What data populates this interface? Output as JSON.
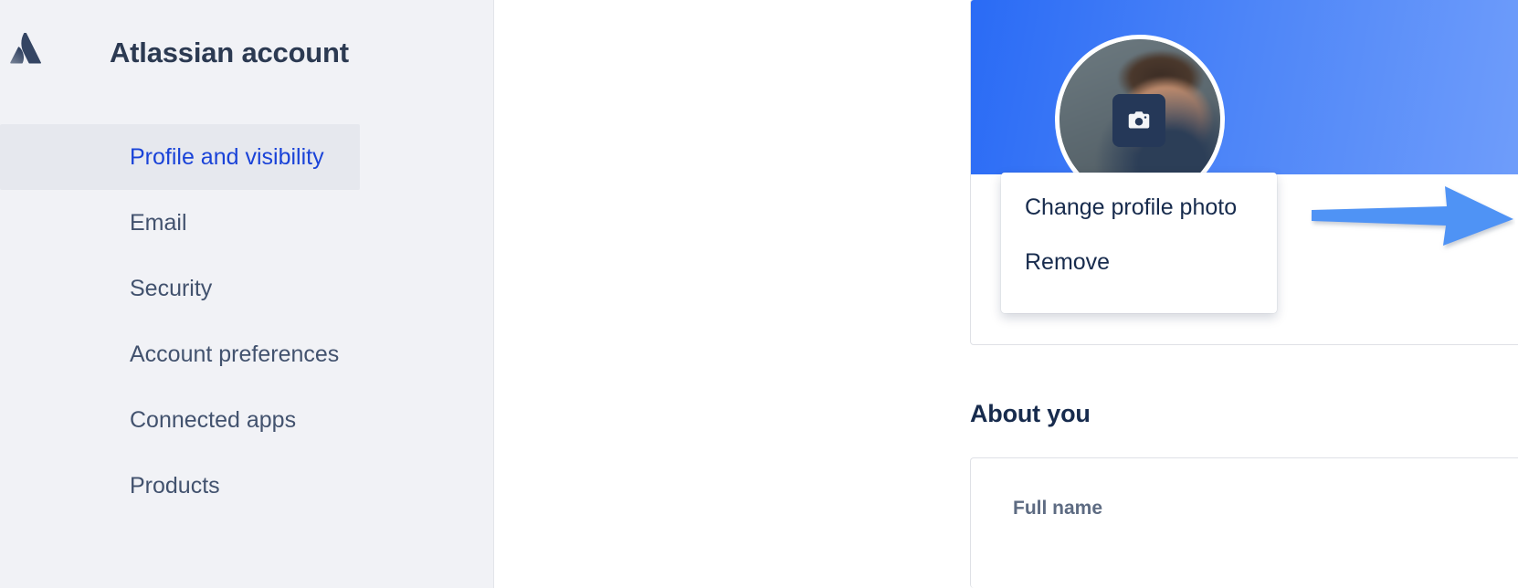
{
  "app": {
    "title": "Atlassian account",
    "logo_icon": "atlassian-logo-icon"
  },
  "sidebar": {
    "items": [
      {
        "label": "Profile and visibility",
        "selected": true
      },
      {
        "label": "Email",
        "selected": false
      },
      {
        "label": "Security",
        "selected": false
      },
      {
        "label": "Account preferences",
        "selected": false
      },
      {
        "label": "Connected apps",
        "selected": false
      },
      {
        "label": "Products",
        "selected": false
      }
    ]
  },
  "profile": {
    "avatar_icon": "avatar",
    "camera_icon": "camera-icon",
    "banner_gradient_from": "#2a6bf5",
    "banner_gradient_to": "#79a4fb"
  },
  "photo_menu": {
    "items": [
      {
        "label": "Change profile photo"
      },
      {
        "label": "Remove"
      }
    ]
  },
  "about": {
    "heading": "About you",
    "full_name_label": "Full name"
  },
  "annotation": {
    "arrow_icon": "arrow-right-icon",
    "color": "#4f93f5"
  },
  "colors": {
    "sidebar_bg": "#f1f2f6",
    "selected_bg": "#e6e8ee",
    "link_blue": "#1a43d8",
    "text_dark": "#172b4d",
    "text_muted": "#42526e"
  }
}
